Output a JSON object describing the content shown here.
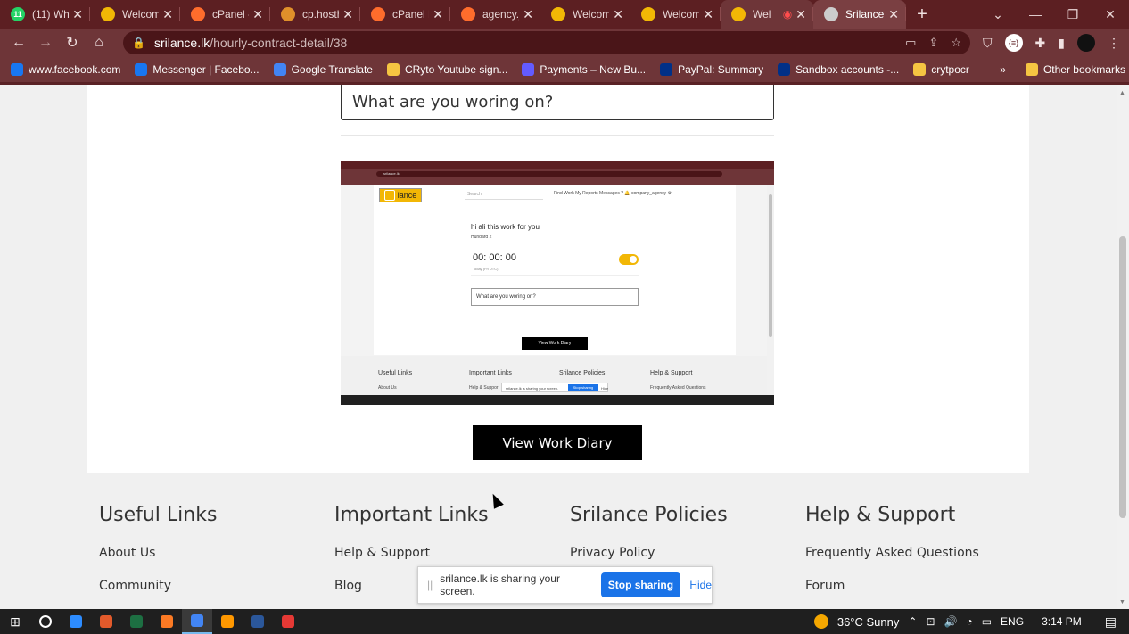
{
  "tabs": [
    {
      "label": "(11) Wh",
      "icon": "whatsapp-icon",
      "color": "#25d366",
      "badge": "11"
    },
    {
      "label": "Welcom",
      "icon": "srilance-icon",
      "color": "#f2b705"
    },
    {
      "label": "cPanel -",
      "icon": "cpanel-icon",
      "color": "#ff6c2c"
    },
    {
      "label": "cp.hosth",
      "icon": "hosting-icon",
      "color": "#e0902a"
    },
    {
      "label": "cPanel F",
      "icon": "cpanel-icon",
      "color": "#ff6c2c"
    },
    {
      "label": "agency.j",
      "icon": "cpanel-icon",
      "color": "#ff6c2c"
    },
    {
      "label": "Welcom",
      "icon": "srilance-icon",
      "color": "#f2b705"
    },
    {
      "label": "Welcom",
      "icon": "srilance-icon",
      "color": "#f2b705"
    },
    {
      "label": "Wel",
      "icon": "srilance-icon",
      "color": "#f2b705",
      "recording": true
    },
    {
      "label": "Srilance",
      "icon": "globe-icon",
      "color": "#cccccc"
    }
  ],
  "address": {
    "host": "srilance.lk",
    "path": "/hourly-contract-detail/38"
  },
  "bookmarks": [
    {
      "label": "www.facebook.com",
      "icon": "facebook-icon",
      "color": "#1877f2"
    },
    {
      "label": "Messenger | Facebo...",
      "icon": "facebook-icon",
      "color": "#1877f2"
    },
    {
      "label": "Google Translate",
      "icon": "translate-icon",
      "color": "#4285f4"
    },
    {
      "label": "CRyto Youtube sign...",
      "icon": "folder-icon",
      "color": "#f5c542"
    },
    {
      "label": "Payments – New Bu...",
      "icon": "stripe-icon",
      "color": "#635bff"
    },
    {
      "label": "PayPal: Summary",
      "icon": "paypal-icon",
      "color": "#003087"
    },
    {
      "label": "Sandbox accounts -...",
      "icon": "paypal-icon",
      "color": "#003087"
    },
    {
      "label": "crytpocr",
      "icon": "folder-icon",
      "color": "#f5c542"
    }
  ],
  "bookmarks_more": "»",
  "other_bookmarks": "Other bookmarks",
  "work_input_placeholder": "What are you woring on?",
  "thumbnail": {
    "logo": "lance",
    "search": "Search",
    "nav": "Find Work    My Reports    Messages    ?    🔔    company_agency    ⚙",
    "title": "hi ali this work for you",
    "subtitle": "Hundard 2",
    "timer": "00: 00: 00",
    "today": "Today (Fri UTC)",
    "input": "What are you woring on?",
    "button": "View Work Diary",
    "footer_heads": [
      "Useful Links",
      "Important Links",
      "Srilance Policies",
      "Help & Support"
    ],
    "footer_links": [
      "About Us",
      "Help & Suppor",
      "",
      "Frequently Asked Questions"
    ],
    "share_text": "srilance.lk is sharing your screen.",
    "share_stop": "Stop sharing",
    "share_hide": "Hide"
  },
  "view_work_diary": "View Work Diary",
  "footer": [
    {
      "heading": "Useful Links",
      "links": [
        "About Us",
        "Community"
      ]
    },
    {
      "heading": "Important Links",
      "links": [
        "Help & Support",
        "Blog"
      ]
    },
    {
      "heading": "Srilance Policies",
      "links": [
        "Privacy Policy"
      ]
    },
    {
      "heading": "Help & Support",
      "links": [
        "Frequently Asked Questions",
        "Forum"
      ]
    }
  ],
  "share_bar": {
    "text": "srilance.lk is sharing your screen.",
    "stop": "Stop sharing",
    "hide": "Hide"
  },
  "taskbar": {
    "apps": [
      {
        "icon": "search-icon",
        "color": "#1f1f1f"
      },
      {
        "icon": "zoom-icon",
        "color": "#2d8cff"
      },
      {
        "icon": "app-icon",
        "color": "#e25a2b"
      },
      {
        "icon": "excel-icon",
        "color": "#1d6f42"
      },
      {
        "icon": "xampp-icon",
        "color": "#fb7a24"
      },
      {
        "icon": "chrome-icon",
        "color": "#4285f4",
        "active": true
      },
      {
        "icon": "sublime-icon",
        "color": "#ff9800"
      },
      {
        "icon": "app-icon",
        "color": "#2b579a"
      },
      {
        "icon": "recorder-icon",
        "color": "#e53935"
      }
    ],
    "weather": "36°C  Sunny",
    "lang": "ENG",
    "time": "3:14 PM"
  }
}
